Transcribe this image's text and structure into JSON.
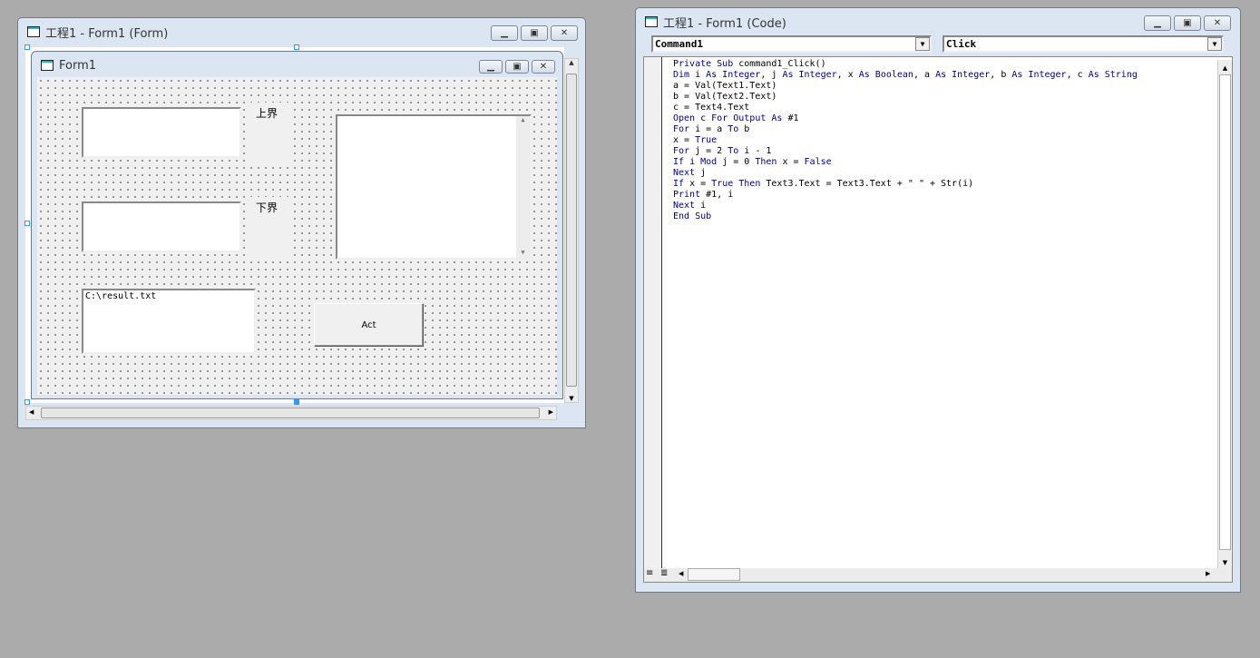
{
  "form_window": {
    "title": "工程1 - Form1 (Form)",
    "inner_title": "Form1",
    "label_upper": "上界",
    "label_lower": "下界",
    "text1": "",
    "text2": "",
    "text3": "",
    "text4": "C:\\result.txt",
    "button": "Act"
  },
  "code_window": {
    "title": "工程1 - Form1 (Code)",
    "object_combo": "Command1",
    "proc_combo": "Click",
    "lines": [
      [
        [
          "k",
          "Private Sub"
        ],
        [
          "t",
          " command1_Click()"
        ]
      ],
      [
        [
          "k",
          "Dim"
        ],
        [
          "t",
          " i "
        ],
        [
          "k",
          "As Integer"
        ],
        [
          "t",
          ", j "
        ],
        [
          "k",
          "As Integer"
        ],
        [
          "t",
          ", x "
        ],
        [
          "k",
          "As Boolean"
        ],
        [
          "t",
          ", a "
        ],
        [
          "k",
          "As Integer"
        ],
        [
          "t",
          ", b "
        ],
        [
          "k",
          "As Integer"
        ],
        [
          "t",
          ", c "
        ],
        [
          "k",
          "As String"
        ]
      ],
      [
        [
          "t",
          "a = Val(Text1.Text)"
        ]
      ],
      [
        [
          "t",
          "b = Val(Text2.Text)"
        ]
      ],
      [
        [
          "t",
          "c = Text4.Text"
        ]
      ],
      [
        [
          "k",
          "Open"
        ],
        [
          "t",
          " c "
        ],
        [
          "k",
          "For Output As"
        ],
        [
          "t",
          " #1"
        ]
      ],
      [
        [
          "k",
          "For"
        ],
        [
          "t",
          " i = a "
        ],
        [
          "k",
          "To"
        ],
        [
          "t",
          " b"
        ]
      ],
      [
        [
          "t",
          "x = "
        ],
        [
          "k",
          "True"
        ]
      ],
      [
        [
          "k",
          "For"
        ],
        [
          "t",
          " j = 2 "
        ],
        [
          "k",
          "To"
        ],
        [
          "t",
          " i - 1"
        ]
      ],
      [
        [
          "k",
          "If"
        ],
        [
          "t",
          " i "
        ],
        [
          "k",
          "Mod"
        ],
        [
          "t",
          " j = 0 "
        ],
        [
          "k",
          "Then"
        ],
        [
          "t",
          " x = "
        ],
        [
          "k",
          "False"
        ]
      ],
      [
        [
          "k",
          "Next"
        ],
        [
          "t",
          " j"
        ]
      ],
      [
        [
          "k",
          "If"
        ],
        [
          "t",
          " x = "
        ],
        [
          "k",
          "True Then"
        ],
        [
          "t",
          " Text3.Text = Text3.Text + \" \" + Str(i)"
        ]
      ],
      [
        [
          "k",
          "Print"
        ],
        [
          "t",
          " #1, i"
        ]
      ],
      [
        [
          "k",
          "Next"
        ],
        [
          "t",
          " i"
        ]
      ],
      [
        [
          "k",
          "End Sub"
        ],
        [
          "t",
          ""
        ]
      ]
    ]
  }
}
